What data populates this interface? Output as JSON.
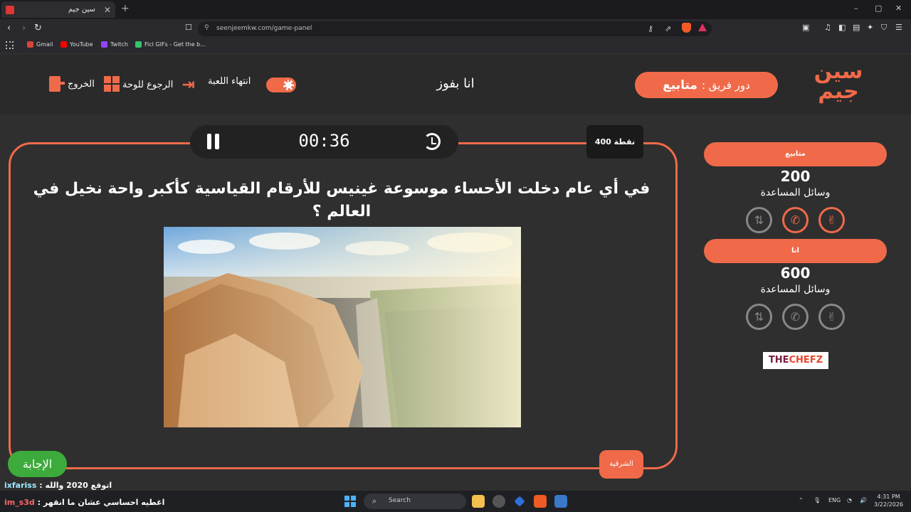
{
  "browser": {
    "tab_title": "سين جيم",
    "new_tab": "+",
    "url": "seenjeemkw.com/game-panel",
    "window_controls": [
      "–",
      "▢",
      "✕"
    ],
    "bookmarks": [
      {
        "label": "Gmail",
        "color": "#d44638"
      },
      {
        "label": "YouTube",
        "color": "#ff0000"
      },
      {
        "label": "Twitch",
        "color": "#9146ff"
      },
      {
        "label": "Ficl GIFs - Get the b...",
        "color": "#36c36b"
      }
    ]
  },
  "header": {
    "logo_line1": "سين",
    "logo_line2": "جيم",
    "turn_prefix": "دور فريق :",
    "turn_team": "متابيع",
    "team_title": "انا بفوز",
    "end_game": "انتهاء اللعبة",
    "back_to_board": "الرجوع للوحة",
    "exit": "الخروج"
  },
  "question_panel": {
    "timer": "00:36",
    "points": "400 نقطة",
    "question": "في أي عام دخلت الأحساء موسوعة غينيس للأرقام القياسية كأكبر واحة نخيل في العالم ؟",
    "category": "الشرقية",
    "answer_button": "الإجابة"
  },
  "teams": [
    {
      "name": "متابيع",
      "score": "200",
      "helpers_label": "وسائل المساعدة",
      "aids_active": [
        true,
        true,
        false
      ]
    },
    {
      "name": "انا",
      "score": "600",
      "helpers_label": "وسائل المساعدة",
      "aids_active": [
        false,
        false,
        false
      ]
    }
  ],
  "sponsor": {
    "part1": "THE",
    "part2": "CHEFZ"
  },
  "chat": [
    {
      "user": "ixfariss",
      "message": "اتوقع 2020 والله"
    },
    {
      "user": "im_s3d",
      "message": "اغطيه احساسي عشان ما انقهر"
    }
  ],
  "taskbar": {
    "search_placeholder": "Search",
    "lang": "ENG",
    "time": "4:31 PM",
    "date": "3/22/2026"
  },
  "colors": {
    "accent": "#f06a4a",
    "answer_green": "#3cab3c",
    "background": "#2f2f2f"
  }
}
